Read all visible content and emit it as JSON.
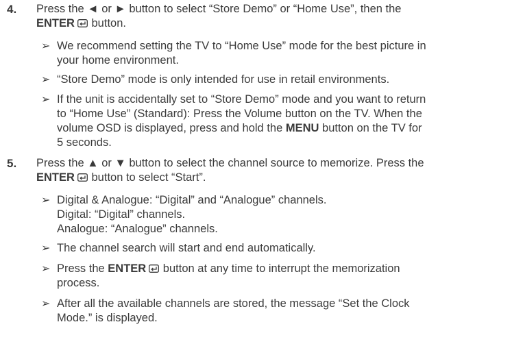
{
  "steps": [
    {
      "number": "4.",
      "line1": "Press the ◄ or ► button to select “Store Demo” or “Home Use”, then the",
      "enter_label": "ENTER",
      "after_icon": " button.",
      "notes": [
        "We recommend setting the TV to “Home Use” mode for the best picture in\nyour home environment.",
        "“Store Demo” mode is only intended for use in retail environments."
      ],
      "note3": {
        "part1": "If the unit is accidentally set to “Store Demo” mode and you want to return\nto “Home Use” (Standard): Press the Volume button on the TV. When the\nvolume OSD is displayed, press and hold the ",
        "bold": "MENU",
        "part2": " button on the TV for\n5 seconds."
      }
    },
    {
      "number": "5.",
      "line1": "Press the ▲ or ▼ button to select the channel source to memorize. Press the",
      "enter_label": "ENTER",
      "after_icon": " button to select “Start”.",
      "notes": [
        "Digital & Analogue: “Digital” and “Analogue” channels.\nDigital: “Digital” channels.\nAnalogue: “Analogue” channels.",
        "The channel search will start and end automatically."
      ],
      "note3": {
        "part1": "Press the ",
        "bold": "ENTER",
        "part2": " button at any time to interrupt the memorization\nprocess."
      },
      "note4": "After all the available channels are stored, the message “Set the Clock\nMode.” is displayed."
    }
  ],
  "note_marker": "➢",
  "icons": {
    "enter": "enter-return-icon"
  }
}
